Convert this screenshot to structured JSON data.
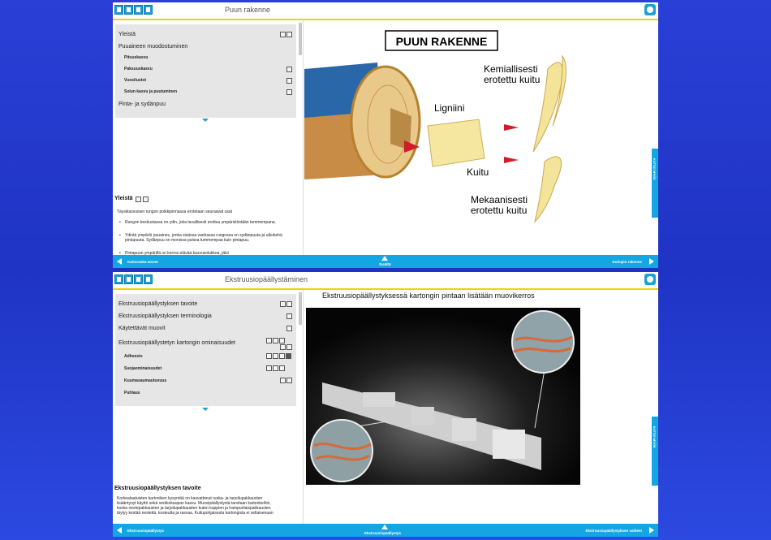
{
  "panel1": {
    "title": "Puun rakenne",
    "toc": [
      {
        "label": "Yleistä",
        "sub": false,
        "icons": [
          "doc",
          "doc"
        ]
      },
      {
        "label": "Puuaineen muodostuminen",
        "sub": false,
        "icons": []
      },
      {
        "label": "Pituuskasvu",
        "sub": true,
        "icons": []
      },
      {
        "label": "Paksuuskasvu",
        "sub": true,
        "icons": [
          "doc"
        ]
      },
      {
        "label": "Vuosilustot",
        "sub": true,
        "icons": [
          "doc"
        ]
      },
      {
        "label": "Solun kasvu ja puutuminen",
        "sub": true,
        "icons": [
          "doc"
        ]
      },
      {
        "label": "Pinta- ja sydänpuu",
        "sub": false,
        "icons": []
      }
    ],
    "section_heading": "Yleistä",
    "intro": "Täysikasvuisen rungon poikkipinnassa erotetaan seuraavat osat",
    "bullets": [
      "Rungon keskustassa on ydin, joka tavallisesti erottuu ympäristöstään tummempana.",
      "Ydintä ympäröi puuaines, jonka sisäosa vanhassa rungossa on sydänpuuta ja ulkokehä pintapuuta. Sydänpuu on monissa puissa tummempaa kuin pintapuu.",
      "Pintapuun ympärillä on kerros elävää kasvusolukkoa, jälsi"
    ],
    "nav_left": "Kuitu­raaka-aineet",
    "nav_center": "Sisältö",
    "nav_right": "Kuitujen rakenne",
    "side_tab": "KATSO MYÖS",
    "figure": {
      "title": "PUUN RAKENNE",
      "label_chemical": [
        "Kemiallisesti",
        "erotettu kuitu"
      ],
      "label_lignin": "Ligniini",
      "label_fiber": "Kuitu",
      "label_mechanical": [
        "Mekaanisesti",
        "erotettu kuitu"
      ]
    }
  },
  "panel2": {
    "title": "Ekstruusiopäällystäminen",
    "toc": [
      {
        "label": "Ekstruusiopäällystyksen tavoite",
        "sub": false,
        "icons": [
          "img",
          "img"
        ]
      },
      {
        "label": "Ekstruusiopäällystyksen terminologia",
        "sub": false,
        "icons": [
          "img"
        ]
      },
      {
        "label": "Käytettävät muovit",
        "sub": false,
        "icons": [
          "img"
        ]
      },
      {
        "label": "Ekstruusiopäällystetyn kartongin ominaisuudet",
        "sub": false,
        "icons": [
          "img",
          "img",
          "img"
        ]
      },
      {
        "label": "Adheesio",
        "sub": true,
        "icons": [
          "img",
          "img",
          "img",
          "play"
        ]
      },
      {
        "label": "Suojaominaisuudet",
        "sub": true,
        "icons": [
          "img",
          "img",
          "img"
        ]
      },
      {
        "label": "Kuumasaumautuvuus",
        "sub": true,
        "icons": [
          "img",
          "img"
        ]
      },
      {
        "label": "Puhlaus",
        "sub": true,
        "icons": []
      }
    ],
    "section_heading": "Ekstruusiopäällystyksen tavoite",
    "paragraph": "Korkealaatuisten kartonkien kysyntää on kasvattanut ruoka- ja tarjoilupakkausten lisääntynyt käyttö sekä verkkokaupan kasvu. Muovipäällystystä tarvitaan kartonkeihin, koska nestepakkausten ja tarjoilupakkausten kuten kuppien ja hampurilaispakkausten täytyy kestää nesteitä, kosteutta ja rasvaa. Kuitupohjaisesta kartongista ei sellaisenaan",
    "figure_title": "Ekstruusiopäällystyksessä kartongin pintaan lisätään muovikerros",
    "nav_left": "Ekstruusiopäällystys",
    "nav_center": "Ekstruusiopäällystys",
    "nav_right": "Ekstruusiopäällystyksen vaiheet",
    "side_tab": "KATSO MYÖS"
  }
}
